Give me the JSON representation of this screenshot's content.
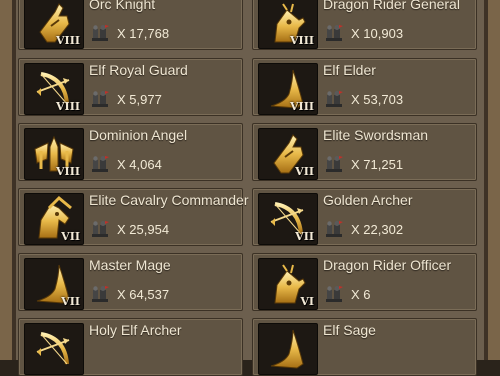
{
  "units": [
    {
      "name": "Orc Knight",
      "tier": "VIII",
      "count": "X 17,768",
      "icon": "helmet-icon"
    },
    {
      "name": "Dragon Rider General",
      "tier": "VIII",
      "count": "X 10,903",
      "icon": "dragon-icon"
    },
    {
      "name": "Elf Royal Guard",
      "tier": "VIII",
      "count": "X 5,977",
      "icon": "bow-icon"
    },
    {
      "name": "Elf Elder",
      "tier": "VIII",
      "count": "X 53,703",
      "icon": "mage-hat-icon"
    },
    {
      "name": "Dominion Angel",
      "tier": "VIII",
      "count": "X 4,064",
      "icon": "angel-icon"
    },
    {
      "name": "Elite Swordsman",
      "tier": "VII",
      "count": "X 71,251",
      "icon": "helmet-icon"
    },
    {
      "name": "Elite Cavalry Commander",
      "tier": "VII",
      "count": "X 25,954",
      "icon": "horse-icon"
    },
    {
      "name": "Golden Archer",
      "tier": "VII",
      "count": "X 22,302",
      "icon": "bow-icon"
    },
    {
      "name": "Master Mage",
      "tier": "VII",
      "count": "X 64,537",
      "icon": "mage-hat-icon"
    },
    {
      "name": "Dragon Rider Officer",
      "tier": "VI",
      "count": "X 6",
      "icon": "dragon-icon"
    },
    {
      "name": "Holy Elf Archer",
      "tier": "",
      "count": "",
      "icon": "bow-icon"
    },
    {
      "name": "Elf Sage",
      "tier": "",
      "count": "",
      "icon": "mage-hat-icon"
    }
  ]
}
